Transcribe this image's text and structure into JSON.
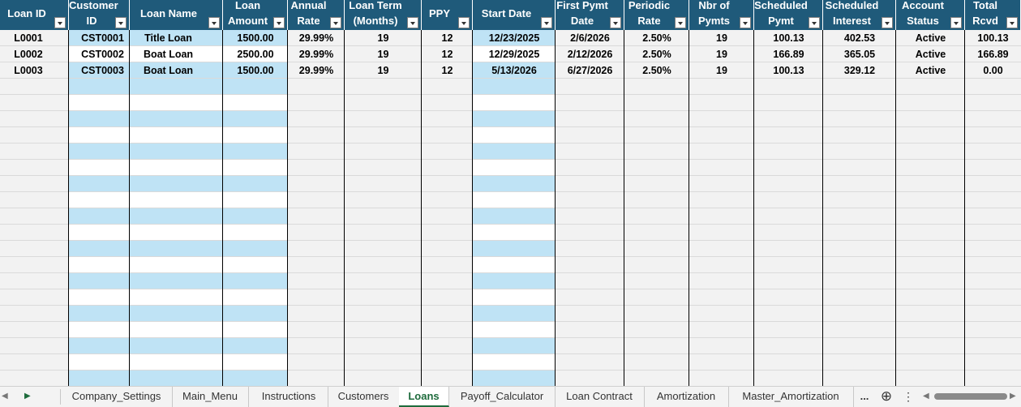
{
  "columns": [
    {
      "key": "loan_id",
      "line1": "Loan ID",
      "line2": ""
    },
    {
      "key": "customer_id",
      "line1": "Customer",
      "line2": "ID"
    },
    {
      "key": "loan_name",
      "line1": "Loan Name",
      "line2": ""
    },
    {
      "key": "loan_amount",
      "line1": "Loan",
      "line2": "Amount"
    },
    {
      "key": "annual_rate",
      "line1": "Annual",
      "line2": "Rate"
    },
    {
      "key": "loan_term",
      "line1": "Loan Term",
      "line2": "(Months)"
    },
    {
      "key": "ppy",
      "line1": "PPY",
      "line2": ""
    },
    {
      "key": "start_date",
      "line1": "Start Date",
      "line2": ""
    },
    {
      "key": "first_pymt_date",
      "line1": "First Pymt",
      "line2": "Date"
    },
    {
      "key": "periodic_rate",
      "line1": "Periodic",
      "line2": "Rate"
    },
    {
      "key": "nbr_of_pymts",
      "line1": "Nbr of",
      "line2": "Pymts"
    },
    {
      "key": "scheduled_pymt",
      "line1": "Scheduled",
      "line2": "Pymt"
    },
    {
      "key": "scheduled_interest",
      "line1": "Scheduled",
      "line2": "Interest"
    },
    {
      "key": "account_status",
      "line1": "Account",
      "line2": "Status"
    },
    {
      "key": "total_rcvd",
      "line1": "Total",
      "line2": "Rcvd"
    }
  ],
  "rows": [
    [
      "L0001",
      "CST0001",
      "Title Loan",
      "1500.00",
      "29.99%",
      "19",
      "12",
      "12/23/2025",
      "2/6/2026",
      "2.50%",
      "19",
      "100.13",
      "402.53",
      "Active",
      "100.13"
    ],
    [
      "L0002",
      "CST0002",
      "Boat Loan",
      "2500.00",
      "29.99%",
      "19",
      "12",
      "12/29/2025",
      "2/12/2026",
      "2.50%",
      "19",
      "166.89",
      "365.05",
      "Active",
      "166.89"
    ],
    [
      "L0003",
      "CST0003",
      "Boat Loan",
      "1500.00",
      "29.99%",
      "19",
      "12",
      "5/13/2026",
      "6/27/2026",
      "2.50%",
      "19",
      "100.13",
      "329.12",
      "Active",
      "0.00"
    ]
  ],
  "colors": {
    "header_bg": "#1f5a7a",
    "input_band": "#bfe3f5",
    "grid_bg": "#f2f2f2",
    "active_tab": "#1e6b3c"
  },
  "tabs": [
    {
      "label": "Company_Settings",
      "active": false
    },
    {
      "label": "Main_Menu",
      "active": false
    },
    {
      "label": "Instructions",
      "active": false
    },
    {
      "label": "Customers",
      "active": false
    },
    {
      "label": "Loans",
      "active": true
    },
    {
      "label": "Payoff_Calculator",
      "active": false
    },
    {
      "label": "Loan Contract",
      "active": false
    },
    {
      "label": "Amortization",
      "active": false
    },
    {
      "label": "Master_Amortization",
      "active": false
    }
  ],
  "tabbar": {
    "more": "...",
    "add_icon": "plus-circle-icon",
    "options_icon": "vertical-dots-icon",
    "next_icon": "caret-right-icon",
    "prev_icon": "caret-left-icon"
  }
}
